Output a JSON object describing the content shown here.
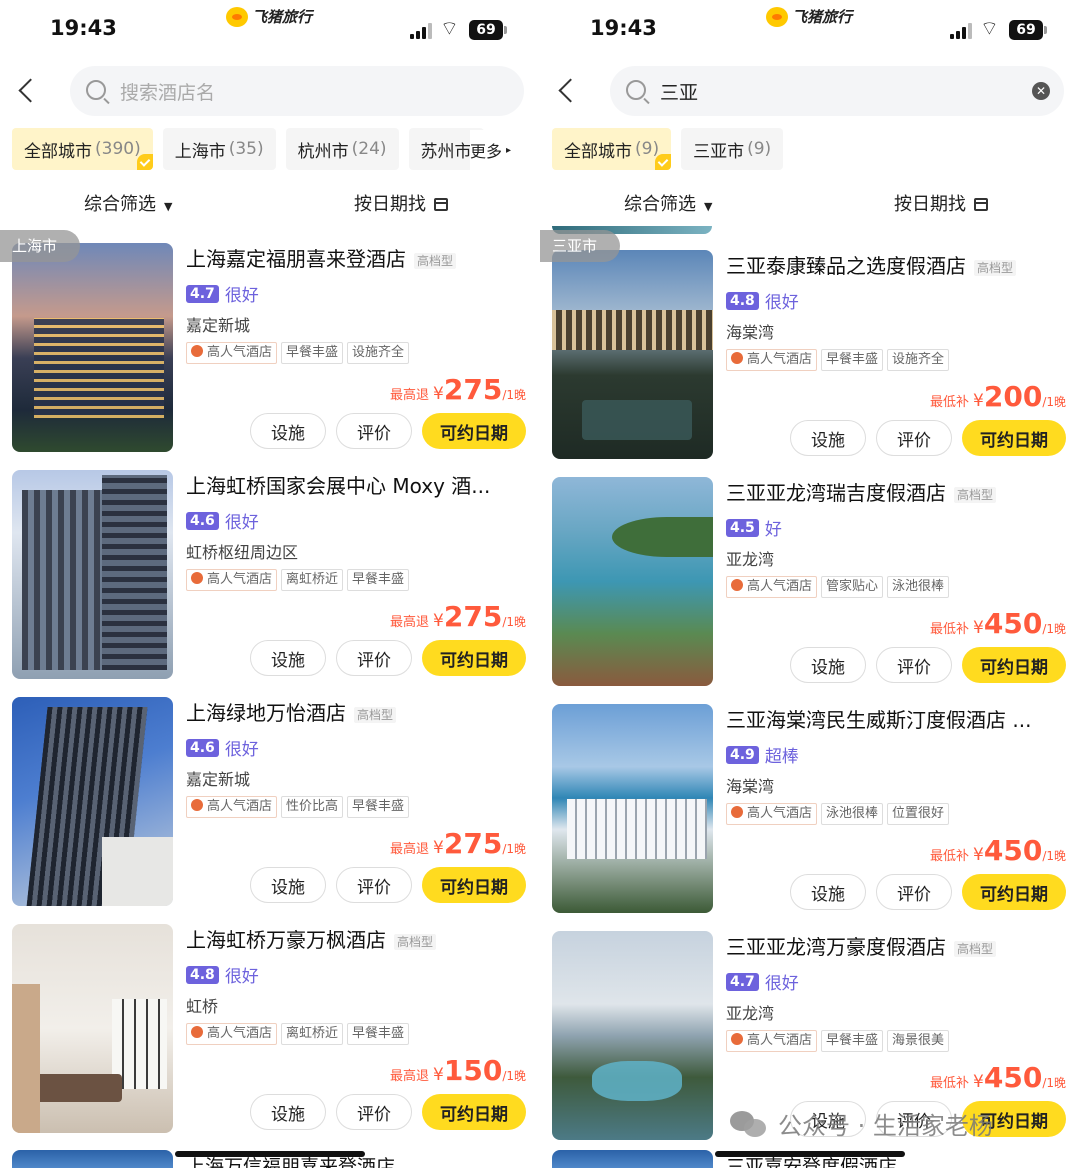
{
  "left": {
    "status": {
      "time": "19:43",
      "battery": "69"
    },
    "brand": "飞猪旅行",
    "search": {
      "text": "搜索酒店名",
      "filled": false
    },
    "chips": [
      {
        "label": "全部城市",
        "count": "(390)",
        "active": true
      },
      {
        "label": "上海市",
        "count": "(35)",
        "active": false
      },
      {
        "label": "杭州市",
        "count": "(24)",
        "active": false
      },
      {
        "label": "苏州市",
        "count": "",
        "active": false
      }
    ],
    "more": "更多",
    "filter": {
      "left": "综合筛选",
      "right": "按日期找"
    },
    "group_label": "上海市",
    "hotels": [
      {
        "name": "上海嘉定福朋喜来登酒店",
        "grade": "高档型",
        "score": "4.7",
        "rating": "很好",
        "area": "嘉定新城",
        "tags": [
          "高人气酒店",
          "早餐丰盛",
          "设施齐全"
        ],
        "price_prefix": "最高退",
        "currency": "¥",
        "price": "275",
        "unit": "/1晚",
        "btn_facility": "设施",
        "btn_review": "评价",
        "btn_dates": "可约日期"
      },
      {
        "name": "上海虹桥国家会展中心 Moxy 酒...",
        "grade": "",
        "score": "4.6",
        "rating": "很好",
        "area": "虹桥枢纽周边区",
        "tags": [
          "高人气酒店",
          "离虹桥近",
          "早餐丰盛"
        ],
        "price_prefix": "最高退",
        "currency": "¥",
        "price": "275",
        "unit": "/1晚",
        "btn_facility": "设施",
        "btn_review": "评价",
        "btn_dates": "可约日期"
      },
      {
        "name": "上海绿地万怡酒店",
        "grade": "高档型",
        "score": "4.6",
        "rating": "很好",
        "area": "嘉定新城",
        "tags": [
          "高人气酒店",
          "性价比高",
          "早餐丰盛"
        ],
        "price_prefix": "最高退",
        "currency": "¥",
        "price": "275",
        "unit": "/1晚",
        "btn_facility": "设施",
        "btn_review": "评价",
        "btn_dates": "可约日期"
      },
      {
        "name": "上海虹桥万豪万枫酒店",
        "grade": "高档型",
        "score": "4.8",
        "rating": "很好",
        "area": "虹桥",
        "tags": [
          "高人气酒店",
          "离虹桥近",
          "早餐丰盛"
        ],
        "price_prefix": "最高退",
        "currency": "¥",
        "price": "150",
        "unit": "/1晚",
        "btn_facility": "设施",
        "btn_review": "评价",
        "btn_dates": "可约日期"
      }
    ],
    "bottom_partial": "上海万信福朋喜来登酒店"
  },
  "right": {
    "status": {
      "time": "19:43",
      "battery": "69"
    },
    "brand": "飞猪旅行",
    "search": {
      "text": "三亚",
      "filled": true
    },
    "chips": [
      {
        "label": "全部城市",
        "count": "(9)",
        "active": true
      },
      {
        "label": "三亚市",
        "count": "(9)",
        "active": false
      }
    ],
    "filter": {
      "left": "综合筛选",
      "right": "按日期找"
    },
    "group_label": "三亚市",
    "hotels": [
      {
        "name": "三亚泰康臻品之选度假酒店",
        "grade": "高档型",
        "score": "4.8",
        "rating": "很好",
        "area": "海棠湾",
        "tags": [
          "高人气酒店",
          "早餐丰盛",
          "设施齐全"
        ],
        "price_prefix": "最低补",
        "currency": "¥",
        "price": "200",
        "unit": "/1晚",
        "btn_facility": "设施",
        "btn_review": "评价",
        "btn_dates": "可约日期"
      },
      {
        "name": "三亚亚龙湾瑞吉度假酒店",
        "grade": "高档型",
        "score": "4.5",
        "rating": "好",
        "area": "亚龙湾",
        "tags": [
          "高人气酒店",
          "管家贴心",
          "泳池很棒"
        ],
        "price_prefix": "最低补",
        "currency": "¥",
        "price": "450",
        "unit": "/1晚",
        "btn_facility": "设施",
        "btn_review": "评价",
        "btn_dates": "可约日期"
      },
      {
        "name": "三亚海棠湾民生威斯汀度假酒店 ...",
        "grade": "",
        "score": "4.9",
        "rating": "超棒",
        "area": "海棠湾",
        "tags": [
          "高人气酒店",
          "泳池很棒",
          "位置很好"
        ],
        "price_prefix": "最低补",
        "currency": "¥",
        "price": "450",
        "unit": "/1晚",
        "btn_facility": "设施",
        "btn_review": "评价",
        "btn_dates": "可约日期"
      },
      {
        "name": "三亚亚龙湾万豪度假酒店",
        "grade": "高档型",
        "score": "4.7",
        "rating": "很好",
        "area": "亚龙湾",
        "tags": [
          "高人气酒店",
          "早餐丰盛",
          "海景很美"
        ],
        "price_prefix": "最低补",
        "currency": "¥",
        "price": "450",
        "unit": "/1晚",
        "btn_facility": "设施",
        "btn_review": "评价",
        "btn_dates": "可约日期"
      }
    ],
    "bottom_partial": "三亚嘉安登度假酒店",
    "watermark": "公众号 · 生活家老杨"
  },
  "colors": {
    "accent_yellow": "#ffdb1f",
    "rating_purple": "#6d62dd",
    "price_red": "#ff5a3c"
  }
}
